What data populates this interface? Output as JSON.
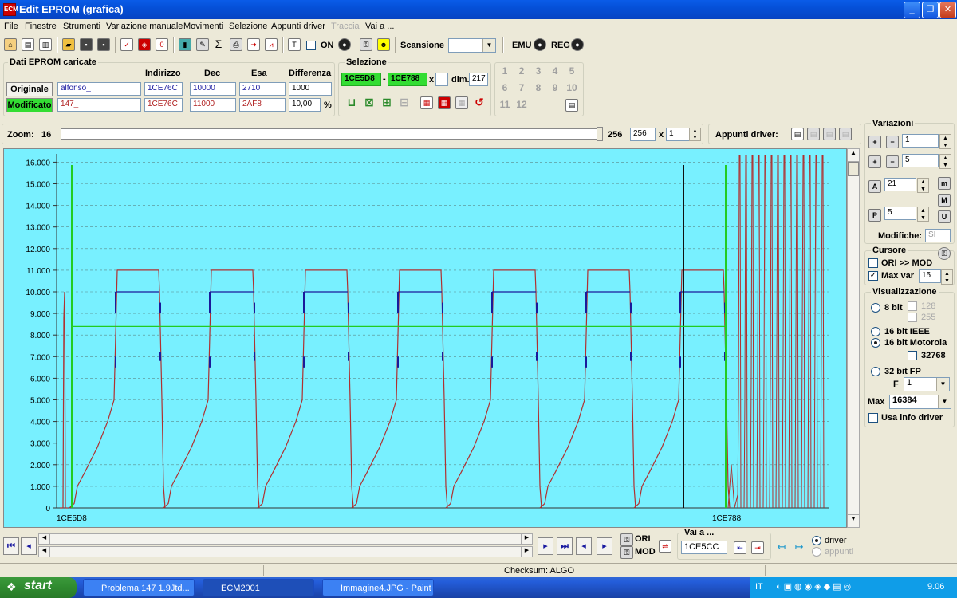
{
  "window": {
    "title": "Edit EPROM (grafica)",
    "app_icon": "ECM"
  },
  "menu": [
    "File",
    "Finestre",
    "Strumenti",
    "Variazione manuale",
    "Movimenti",
    "Selezione",
    "Appunti driver",
    "Traccia",
    "Vai a ..."
  ],
  "toolbar": {
    "on_label": "ON",
    "scansione_label": "Scansione",
    "scansione_value": "",
    "emu_label": "EMU",
    "reg_label": "REG"
  },
  "dati": {
    "title": "Dati EPROM caricate",
    "col_indirizzo": "Indirizzo",
    "col_dec": "Dec",
    "col_esa": "Esa",
    "col_diff": "Differenza",
    "originale": {
      "label": "Originale",
      "name": "alfonso_",
      "indirizzo": "1CE76C",
      "dec": "10000",
      "esa": "2710",
      "diff": "1000"
    },
    "modificato": {
      "label": "Modificato",
      "name": "147_",
      "indirizzo": "1CE76C",
      "dec": "11000",
      "esa": "2AF8",
      "diff": "10,00",
      "unit": "%"
    }
  },
  "selezione": {
    "title": "Selezione",
    "start": "1CE5D8",
    "dash": "-",
    "end": "1CE788",
    "x_label": "x",
    "x_value": "",
    "dim_label": "dim.",
    "dim_value": "217"
  },
  "numpad": [
    "1",
    "2",
    "3",
    "4",
    "5",
    "6",
    "7",
    "8",
    "9",
    "10",
    "11",
    "12"
  ],
  "zoom": {
    "label": "Zoom:",
    "value": "16",
    "max_label": "256",
    "max_value": "256",
    "x_label": "x",
    "mult": "1"
  },
  "appunti_label": "Appunti driver:",
  "variazioni": {
    "title": "Variazioni",
    "v1": "1",
    "v2": "5",
    "v3": "21",
    "v4": "5",
    "modifiche_label": "Modifiche:",
    "modifiche_value": "SI"
  },
  "cursore": {
    "title": "Cursore",
    "ori_mod_label": "ORI >> MOD",
    "max_var_label": "Max var",
    "max_var_value": "15"
  },
  "visualizzazione": {
    "title": "Visualizzazione",
    "bit8": "8 bit",
    "c128": "128",
    "c255": "255",
    "ieee": "16 bit IEEE",
    "motorola": "16 bit Motorola",
    "c32768": "32768",
    "fp32": "32 bit FP",
    "f_label": "F",
    "f_value": "1",
    "max_label": "Max",
    "max_value": "16384",
    "usa_info": "Usa info driver"
  },
  "bottom": {
    "ori": "ORI",
    "mod": "MOD",
    "vai_label": "Vai a ...",
    "vai_value": "1CE5CC",
    "driver": "driver",
    "appunti": "appunti",
    "checksum": "Checksum: ALGO"
  },
  "chart_data": {
    "type": "line",
    "y_ticks": [
      "0",
      "1.000",
      "2.000",
      "3.000",
      "4.000",
      "5.000",
      "6.000",
      "7.000",
      "8.000",
      "9.000",
      "10.000",
      "11.000",
      "12.000",
      "13.000",
      "14.000",
      "15.000",
      "16.000"
    ],
    "ylim": [
      0,
      16384
    ],
    "x_labels": [
      "1CE5D8",
      "1CE788"
    ],
    "grid": true,
    "series": [
      {
        "color": "#b03030",
        "pattern": "cycle",
        "peak": 11000,
        "cycles": 7
      },
      {
        "color": "#1a1a9a",
        "pattern": "plateau",
        "value": 10000,
        "cycles": 7
      }
    ],
    "cursor_value": 8400,
    "colors": {
      "background": "#78f0ff",
      "ori_line": "#1a1a9a",
      "mod_line": "#b03030",
      "cursor": "#22cc22"
    }
  },
  "taskbar": {
    "start": "start",
    "tasks": [
      "Problema 147 1.9Jtd...",
      "ECM2001",
      "Immagine4.JPG - Paint"
    ],
    "lang": "IT",
    "time": "9.06"
  }
}
